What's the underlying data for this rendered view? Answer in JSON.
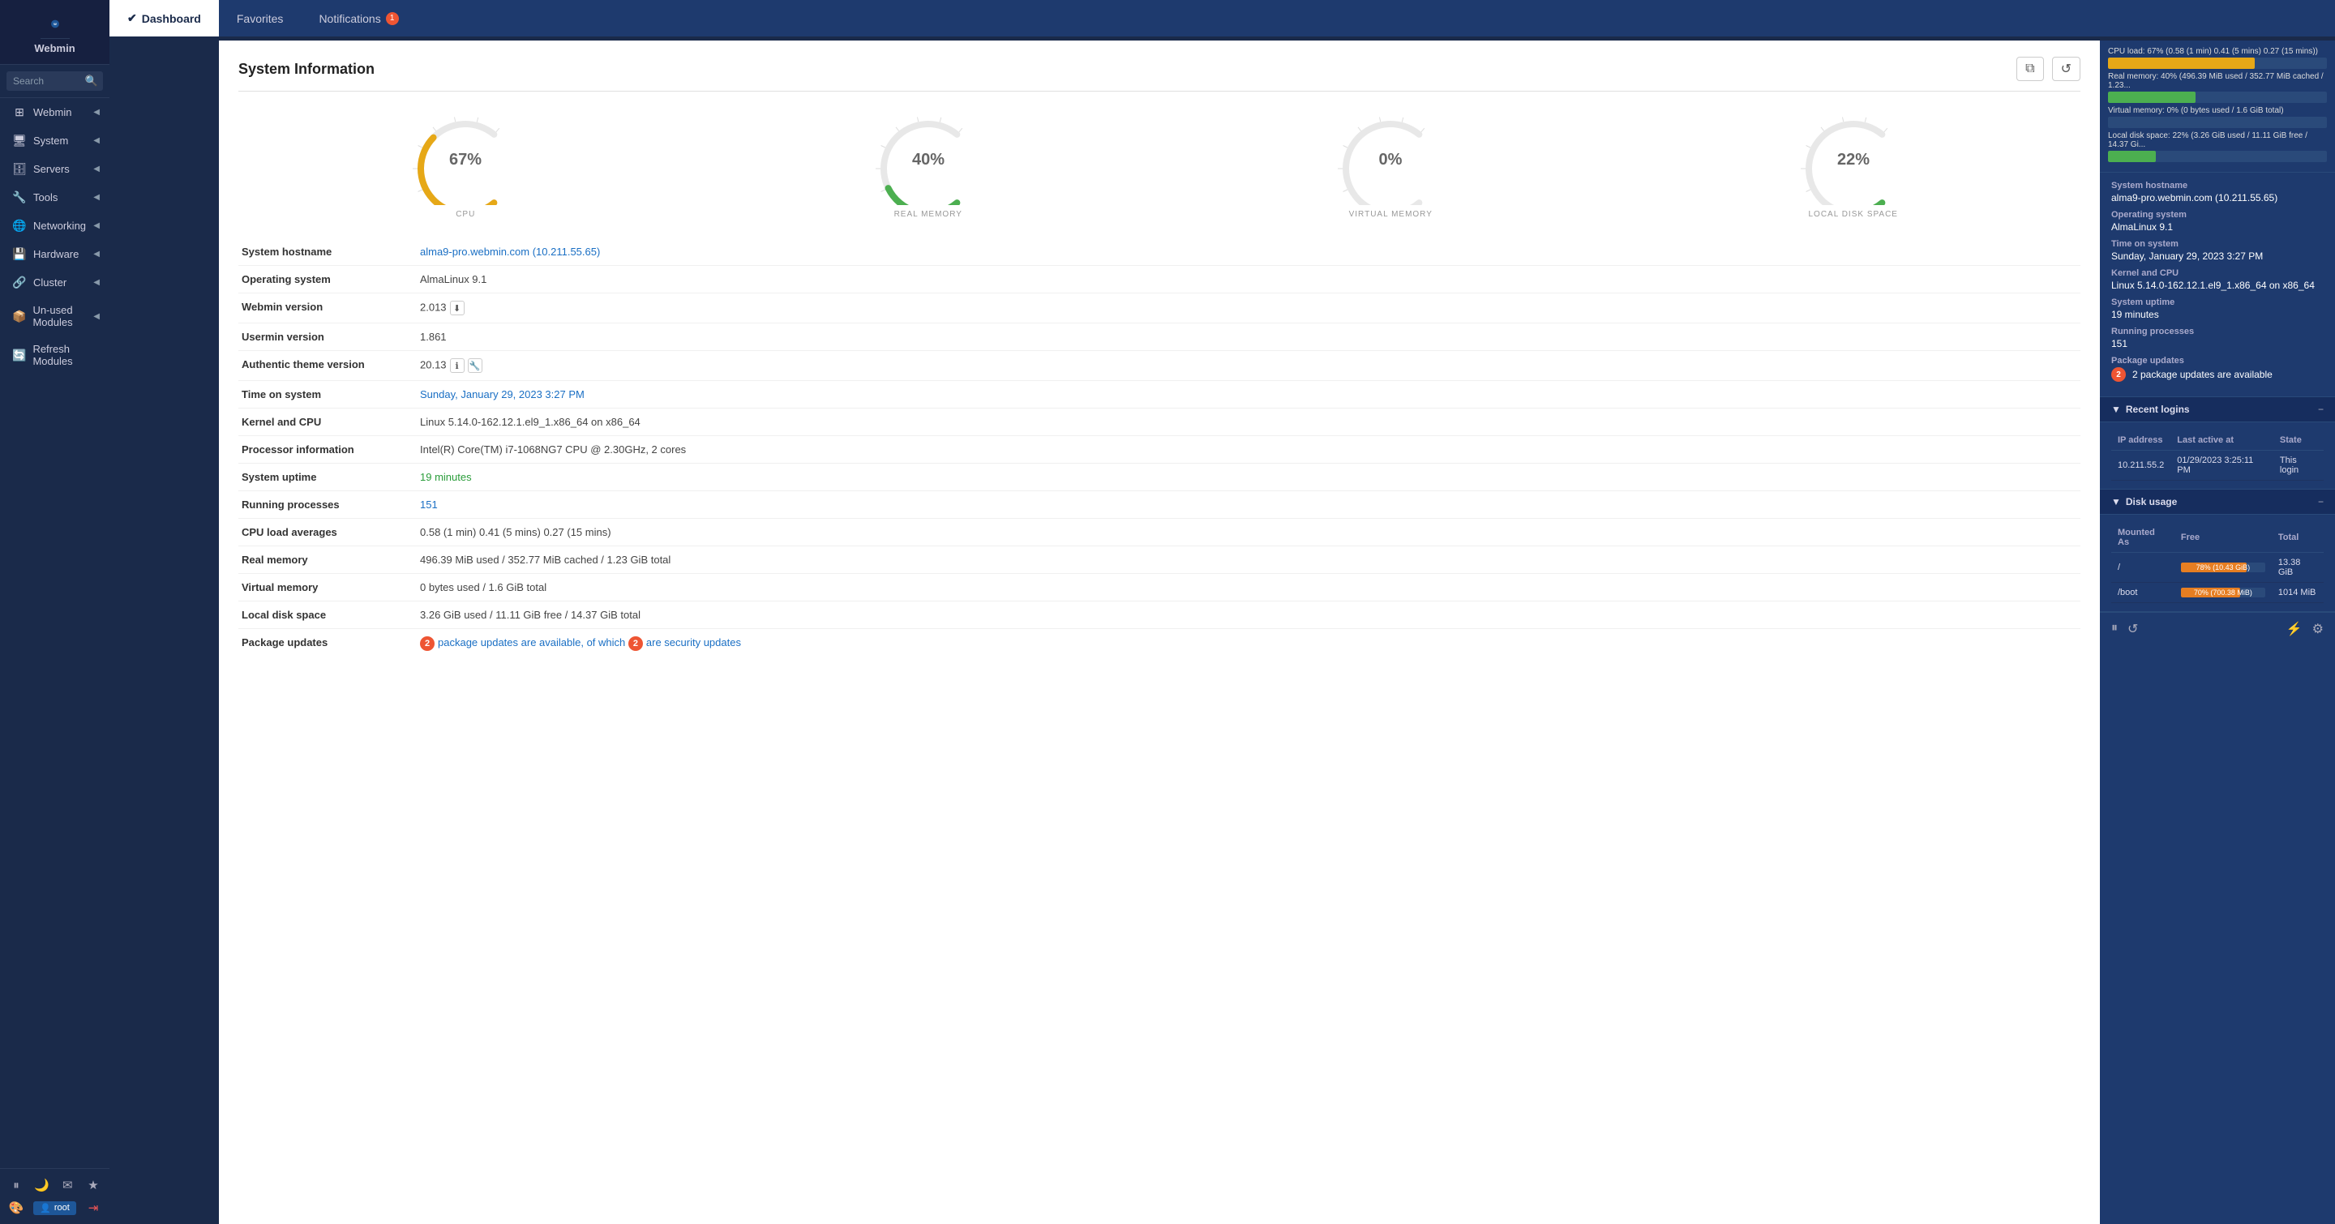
{
  "sidebar": {
    "app_name": "Webmin",
    "search_placeholder": "Search",
    "nav_items": [
      {
        "id": "webmin",
        "label": "Webmin",
        "icon": "⊞",
        "has_arrow": true
      },
      {
        "id": "system",
        "label": "System",
        "icon": "🖥",
        "has_arrow": true
      },
      {
        "id": "servers",
        "label": "Servers",
        "icon": "🗄",
        "has_arrow": true
      },
      {
        "id": "tools",
        "label": "Tools",
        "icon": "🔧",
        "has_arrow": true
      },
      {
        "id": "networking",
        "label": "Networking",
        "icon": "🌐",
        "has_arrow": true
      },
      {
        "id": "hardware",
        "label": "Hardware",
        "icon": "💾",
        "has_arrow": true
      },
      {
        "id": "cluster",
        "label": "Cluster",
        "icon": "🔗",
        "has_arrow": true
      },
      {
        "id": "unused",
        "label": "Un-used Modules",
        "icon": "📦",
        "has_arrow": true
      },
      {
        "id": "refresh",
        "label": "Refresh Modules",
        "icon": "🔄",
        "has_arrow": false
      }
    ],
    "footer_icons": [
      "⏸",
      "🌙",
      "✉",
      "★",
      "🎨"
    ],
    "user_label": "root"
  },
  "topnav": {
    "tabs": [
      {
        "id": "dashboard",
        "label": "Dashboard",
        "active": true
      },
      {
        "id": "favorites",
        "label": "Favorites",
        "active": false
      },
      {
        "id": "notifications",
        "label": "Notifications",
        "active": false,
        "badge": "1"
      }
    ]
  },
  "main": {
    "card_title": "System Information",
    "gauges": [
      {
        "id": "cpu",
        "label": "CPU",
        "percent": 67,
        "color": "#e6a817"
      },
      {
        "id": "real_memory",
        "label": "REAL MEMORY",
        "percent": 40,
        "color": "#4caf50"
      },
      {
        "id": "virtual_memory",
        "label": "VIRTUAL MEMORY",
        "percent": 0,
        "color": "#4caf50"
      },
      {
        "id": "local_disk",
        "label": "LOCAL DISK SPACE",
        "percent": 22,
        "color": "#4caf50"
      }
    ],
    "info_rows": [
      {
        "label": "System hostname",
        "value": "alma9-pro.webmin.com (10.211.55.65)",
        "type": "link_blue"
      },
      {
        "label": "Operating system",
        "value": "AlmaLinux 9.1",
        "type": "text"
      },
      {
        "label": "Webmin version",
        "value": "2.013",
        "type": "text_icon"
      },
      {
        "label": "Usermin version",
        "value": "1.861",
        "type": "text"
      },
      {
        "label": "Authentic theme version",
        "value": "20.13",
        "type": "text_icons2"
      },
      {
        "label": "Time on system",
        "value": "Sunday, January 29, 2023 3:27 PM",
        "type": "link_blue"
      },
      {
        "label": "Kernel and CPU",
        "value": "Linux 5.14.0-162.12.1.el9_1.x86_64 on x86_64",
        "type": "text"
      },
      {
        "label": "Processor information",
        "value": "Intel(R) Core(TM) i7-1068NG7 CPU @ 2.30GHz, 2 cores",
        "type": "text"
      },
      {
        "label": "System uptime",
        "value": "19 minutes",
        "type": "link_green"
      },
      {
        "label": "Running processes",
        "value": "151",
        "type": "link_blue"
      },
      {
        "label": "CPU load averages",
        "value": "0.58 (1 min) 0.41 (5 mins) 0.27 (15 mins)",
        "type": "text"
      },
      {
        "label": "Real memory",
        "value": "496.39 MiB used / 352.77 MiB cached / 1.23 GiB total",
        "type": "text"
      },
      {
        "label": "Virtual memory",
        "value": "0 bytes used / 1.6 GiB total",
        "type": "text"
      },
      {
        "label": "Local disk space",
        "value": "3.26 GiB used / 11.11 GiB free / 14.37 GiB total",
        "type": "text"
      },
      {
        "label": "Package updates",
        "value": "",
        "type": "pkg_updates",
        "pkg_count": "2",
        "pkg_text": "package updates are available, of which",
        "pkg_count2": "2",
        "pkg_text2": "are security updates"
      }
    ]
  },
  "rightpanel": {
    "mini_bars": [
      {
        "label": "CPU load: 67% (0.58 (1 min) 0.41 (5 mins) 0.27 (15 mins))",
        "fill_pct": 67,
        "color": "#e6a817"
      },
      {
        "label": "Real memory: 40% (496.39 MiB used / 352.77 MiB cached / 1.23...",
        "fill_pct": 40,
        "color": "#4caf50"
      },
      {
        "label": "Virtual memory: 0% (0 bytes used / 1.6 GiB total)",
        "fill_pct": 0,
        "color": "#4caf50"
      },
      {
        "label": "Local disk space: 22% (3.26 GiB used / 11.11 GiB free / 14.37 Gi...",
        "fill_pct": 22,
        "color": "#4caf50"
      }
    ],
    "stats": [
      {
        "label": "System hostname",
        "value": "alma9-pro.webmin.com (10.211.55.65)"
      },
      {
        "label": "Operating system",
        "value": "AlmaLinux 9.1"
      },
      {
        "label": "Time on system",
        "value": "Sunday, January 29, 2023 3:27 PM"
      },
      {
        "label": "Kernel and CPU",
        "value": "Linux 5.14.0-162.12.1.el9_1.x86_64 on x86_64"
      },
      {
        "label": "System uptime",
        "value": "19 minutes"
      },
      {
        "label": "Running processes",
        "value": "151"
      },
      {
        "label": "Package updates",
        "value": "2 package updates are available"
      }
    ],
    "recent_logins_title": "Recent logins",
    "recent_logins": [
      {
        "ip": "10.211.55.2",
        "last_active": "01/29/2023 3:25:11 PM",
        "state": "This login",
        "is_current": true
      }
    ],
    "disk_usage_title": "Disk usage",
    "disk_usage": [
      {
        "mounted": "/",
        "free": "78% (10.43 GiB)",
        "total": "13.38 GiB",
        "pct": 78
      },
      {
        "mounted": "/boot",
        "free": "70% (700.38 MiB)",
        "total": "1014 MiB",
        "pct": 70
      }
    ],
    "footer_icons": [
      "⏸",
      "↺",
      "⚡",
      "⚙"
    ]
  }
}
